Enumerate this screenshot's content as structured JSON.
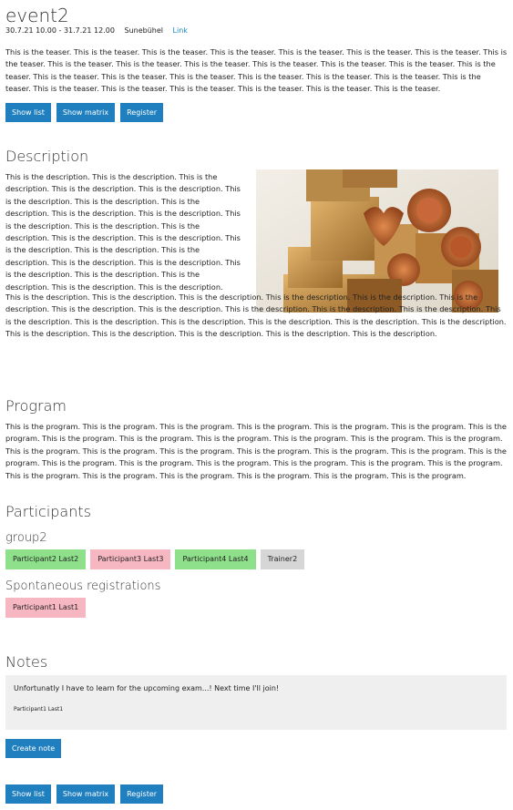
{
  "event": {
    "title": "event2",
    "date": "30.7.21 10.00 - 31.7.21 12.00",
    "location": "Sunebühel",
    "link_label": "Link",
    "teaser": "This is the teaser. This is the teaser. This is the teaser. This is the teaser. This is the teaser. This is the teaser. This is the teaser. This is the teaser. This is the teaser. This is the teaser. This is the teaser. This is the teaser. This is the teaser. This is the teaser. This is the teaser. This is the teaser. This is the teaser. This is the teaser. This is the teaser. This is the teaser. This is the teaser. This is the teaser. This is the teaser. This is the teaser. This is the teaser. This is the teaser. This is the teaser. This is the teaser."
  },
  "buttons": {
    "show_list": "Show list",
    "show_matrix": "Show matrix",
    "register": "Register",
    "create_note": "Create note"
  },
  "description": {
    "heading": "Description",
    "part1": "This is the description. This is the description. This is the description. This is the description. This is the description. This is the description. This is the description. This is the description. This is the description. This is the description. This is the description. This is the description. This is the description. This is the description. This is the description. This is the description. This is the description. This is the description. This is the description. This is the description. This is the description. This is the description. This is the description. This is the description. This is the description.",
    "part2": "This is the description. This is the description. This is the description. This is the description. This is the description. This is the description. This is the description. This is the description. This is the description. This is the description. This is the description. This is the description. This is the description. This is the description. This is the description. This is the description. This is the description. This is the description. This is the description. This is the description. This is the description. This is the description."
  },
  "program": {
    "heading": "Program",
    "text": "This is the program. This is the program. This is the program. This is the program. This is the program. This is the program. This is the program. This is the program. This is the program. This is the program. This is the program. This is the program. This is the program. This is the program. This is the program. This is the program. This is the program. This is the program. This is the program. This is the program. This is the program. This is the program. This is the program. This is the program. This is the program. This is the program. This is the program. This is the program. This is the program. This is the program. This is the program. This is the program."
  },
  "participants": {
    "heading": "Participants",
    "group_name": "group2",
    "group_chips": [
      "Participant2 Last2",
      "Participant3 Last3",
      "Participant4 Last4",
      "Trainer2"
    ],
    "spontaneous_heading": "Spontaneous registrations",
    "spontaneous_chips": [
      "Participant1 Last1"
    ]
  },
  "notes": {
    "heading": "Notes",
    "note_text": "Unfortunatly I have to learn for the upcoming exam...! Next time I'll join!",
    "note_author": "Participant1 Last1"
  },
  "colors": {
    "button_blue": "#1f7fbf",
    "chip_green": "#8fe08a",
    "chip_pink": "#f7b7c2",
    "chip_gray": "#d6d6d6"
  }
}
